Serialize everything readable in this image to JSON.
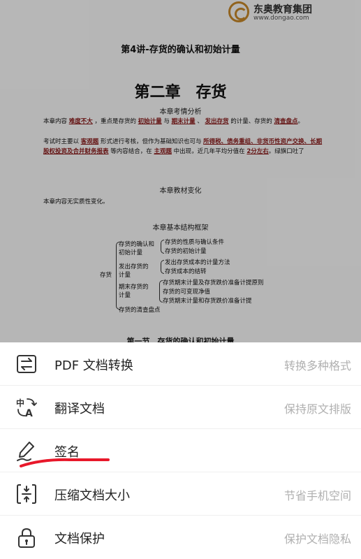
{
  "logo": {
    "name": "东奥教育集团",
    "url": "www.dongao.com"
  },
  "document": {
    "header": "第4讲-存货的确认和初始计量",
    "chapter_title": "第二章　存货",
    "section1": {
      "heading": "本章考情分析",
      "p1_a": "本章内容",
      "p1_hl1": "难度不大",
      "p1_b": "，重点是存货的",
      "p1_hl2": "初始计量",
      "p1_c": "与",
      "p1_hl3": "期末计量",
      "p1_d": "、",
      "p1_hl4": "发出存货",
      "p1_e": "的计量、存货的",
      "p1_hl5": "清查盘点",
      "p1_f": "。",
      "p2_a": "考试时主要以",
      "p2_hl1": "客观题",
      "p2_b": "形式进行考核，但作为基础知识也可与",
      "p2_hl2": "所得税、债务重组、非货币性资产交换、长期股权投资及合并财务报表",
      "p2_c": "等内容结合，在",
      "p2_hl3": "主观题",
      "p2_d": "中出现，近几年平均分值在",
      "p2_hl4": "2分左右",
      "p2_e": "。绿旗口吐了"
    },
    "section2": {
      "heading": "本章教材变化",
      "text": "本章内容无实质性变化。"
    },
    "section3": {
      "heading": "本章基本结构框架",
      "root": "存货",
      "branches": [
        {
          "label": "存货的确认和初始计量",
          "children": [
            "存货的性质与确认条件",
            "存货的初始计量"
          ]
        },
        {
          "label": "发出存货的计量",
          "children": [
            "发出存货成本的计量方法",
            "存货成本的结转"
          ]
        },
        {
          "label": "期末存货的计量",
          "children": [
            "存货期末计量及存货跌价准备计提原则",
            "存货的可变现净值",
            "存货期末计量和存货跌价准备计提"
          ]
        },
        {
          "label": "存货的清查盘点",
          "children": []
        }
      ]
    },
    "section_next": "第一节　存货的确认和初始计量"
  },
  "menu": [
    {
      "label": "PDF 文档转换",
      "desc": "转换多种格式",
      "icon": "convert-icon"
    },
    {
      "label": "翻译文档",
      "desc": "保持原文排版",
      "icon": "translate-icon"
    },
    {
      "label": "签名",
      "desc": "",
      "icon": "signature-icon"
    },
    {
      "label": "压缩文档大小",
      "desc": "节省手机空间",
      "icon": "compress-icon"
    },
    {
      "label": "文档保护",
      "desc": "保护文档隐私",
      "icon": "lock-icon"
    }
  ],
  "colors": {
    "highlight": "#8b1a1a",
    "annotation": "#e8182a",
    "desc_text": "#b0b0b0"
  }
}
